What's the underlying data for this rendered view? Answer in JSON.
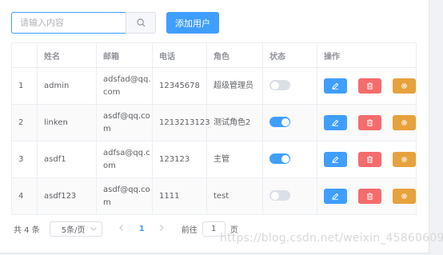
{
  "toolbar": {
    "search_placeholder": "请输入内容",
    "search_icon": "search-icon",
    "add_label": "添加用户"
  },
  "table": {
    "headers": [
      "",
      "姓名",
      "邮箱",
      "电话",
      "角色",
      "状态",
      "操作"
    ],
    "rows": [
      {
        "index": "1",
        "name": "admin",
        "email": "adsfad@qq.com",
        "phone": "12345678",
        "role": "超级管理员",
        "status": false
      },
      {
        "index": "2",
        "name": "linken",
        "email": "asdf@qq.com",
        "phone": "1213213123",
        "role": "测试角色2",
        "status": true
      },
      {
        "index": "3",
        "name": "asdf1",
        "email": "adfsa@qq.com",
        "phone": "123123",
        "role": "主管",
        "status": true
      },
      {
        "index": "4",
        "name": "asdf123",
        "email": "asdf@qq.com",
        "phone": "1111",
        "role": "test",
        "status": false
      }
    ],
    "action_icons": [
      "edit-icon",
      "delete-icon",
      "setting-icon"
    ]
  },
  "pagination": {
    "total_label": "共 4 条",
    "page_size": "5条/页",
    "current_page": "1",
    "goto_label": "前往",
    "goto_value": "1",
    "goto_suffix": "页"
  },
  "watermark": "https://blog.csdn.net/weixin_45860609",
  "colors": {
    "primary": "#409eff",
    "danger": "#f56c6c",
    "warning": "#e6a23c",
    "switch_off": "#dcdfe6"
  }
}
